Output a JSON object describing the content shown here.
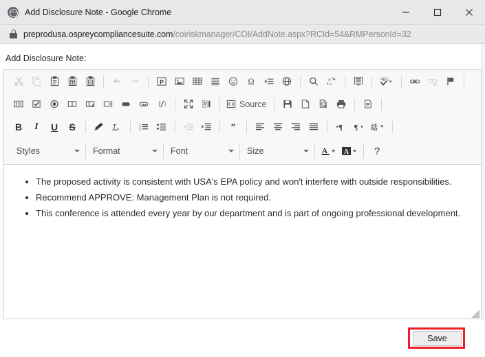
{
  "window": {
    "title": "Add Disclosure Note - Google Chrome",
    "favicon": "globe-icon",
    "controls": {
      "minimize": "minimize-icon",
      "maximize": "maximize-icon",
      "close": "close-icon"
    }
  },
  "address_bar": {
    "lock": "lock-icon",
    "host": "preprodusa.ospreycompliancesuite.com",
    "path": "/coiriskmanager/COI/AddNote.aspx?RCId=54&RMPersonId=32",
    "full_url": "preprodusa.ospreycompliancesuite.com/coiriskmanager/COI/AddNote.aspx?RCId=54&RMPersonId=32"
  },
  "page": {
    "label": "Add Disclosure Note:"
  },
  "editor": {
    "toolbar_rows": [
      {
        "name": "clipboard-and-insert-row",
        "items": [
          {
            "name": "cut-button",
            "icon": "scissors-icon",
            "label": "Cut",
            "disabled": true
          },
          {
            "name": "copy-button",
            "icon": "copy-icon",
            "label": "Copy",
            "disabled": true
          },
          {
            "name": "paste-button",
            "icon": "paste-icon",
            "label": "Paste",
            "disabled": false
          },
          {
            "name": "paste-as-plain-text-button",
            "icon": "paste-text-icon",
            "label": "Paste as plain text",
            "disabled": false
          },
          {
            "name": "paste-from-word-button",
            "icon": "paste-word-icon",
            "label": "Paste from Word",
            "disabled": false
          },
          {
            "name": "separator",
            "icon": "separator",
            "label": "",
            "disabled": false
          },
          {
            "name": "undo-button",
            "icon": "undo-arrow-icon",
            "label": "Undo",
            "disabled": true
          },
          {
            "name": "redo-button",
            "icon": "redo-arrow-icon",
            "label": "Redo",
            "disabled": true
          },
          {
            "name": "separator",
            "icon": "separator",
            "label": "",
            "disabled": false
          },
          {
            "name": "insert-placeholder-button",
            "icon": "placeholder-p-icon",
            "label": "Placeholder",
            "disabled": false
          },
          {
            "name": "insert-image-button",
            "icon": "image-icon",
            "label": "Image",
            "disabled": false
          },
          {
            "name": "insert-table-button",
            "icon": "table-icon",
            "label": "Table",
            "disabled": false
          },
          {
            "name": "insert-horizontal-line-button",
            "icon": "horizontal-line-icon",
            "label": "Horizontal Line",
            "disabled": false
          },
          {
            "name": "insert-smiley-button",
            "icon": "smiley-icon",
            "label": "Smiley",
            "disabled": false
          },
          {
            "name": "insert-special-character-button",
            "icon": "omega-icon",
            "label": "Special Character",
            "disabled": false
          },
          {
            "name": "insert-page-break-button",
            "icon": "page-break-icon",
            "label": "Page Break",
            "disabled": false
          },
          {
            "name": "insert-iframe-button",
            "icon": "globe-iframe-icon",
            "label": "IFrame",
            "disabled": false
          },
          {
            "name": "separator",
            "icon": "separator",
            "label": "",
            "disabled": false
          },
          {
            "name": "find-button",
            "icon": "magnifier-icon",
            "label": "Find",
            "disabled": false
          },
          {
            "name": "replace-button",
            "icon": "replace-ba-icon",
            "label": "Replace",
            "disabled": false
          },
          {
            "name": "separator",
            "icon": "separator",
            "label": "",
            "disabled": false
          },
          {
            "name": "select-all-button",
            "icon": "select-all-icon",
            "label": "Select All",
            "disabled": false
          },
          {
            "name": "separator",
            "icon": "separator",
            "label": "",
            "disabled": false
          },
          {
            "name": "spell-check-button",
            "icon": "spellcheck-abc-icon",
            "label": "Spell Check As You Type",
            "disabled": false
          },
          {
            "name": "separator",
            "icon": "separator",
            "label": "",
            "disabled": false
          },
          {
            "name": "link-button",
            "icon": "link-icon",
            "label": "Link",
            "disabled": false
          },
          {
            "name": "unlink-button",
            "icon": "unlink-icon",
            "label": "Unlink",
            "disabled": true
          },
          {
            "name": "anchor-button",
            "icon": "flag-anchor-icon",
            "label": "Anchor",
            "disabled": false
          },
          {
            "name": "separator",
            "icon": "separator",
            "label": "",
            "disabled": false
          }
        ]
      },
      {
        "name": "forms-and-document-row",
        "items": [
          {
            "name": "form-button",
            "icon": "form-icon",
            "label": "Form",
            "disabled": false
          },
          {
            "name": "checkbox-button",
            "icon": "checkbox-icon",
            "label": "Checkbox",
            "disabled": false
          },
          {
            "name": "radio-button",
            "icon": "radio-button-icon",
            "label": "Radio Button",
            "disabled": false
          },
          {
            "name": "text-field-button",
            "icon": "text-field-icon",
            "label": "Text Field",
            "disabled": false
          },
          {
            "name": "textarea-button",
            "icon": "textarea-icon",
            "label": "Textarea",
            "disabled": false
          },
          {
            "name": "selection-field-button",
            "icon": "select-dropdown-icon",
            "label": "Selection Field",
            "disabled": false
          },
          {
            "name": "button-button",
            "icon": "button-icon",
            "label": "Button",
            "disabled": false
          },
          {
            "name": "image-button-button",
            "icon": "image-button-icon",
            "label": "Image Button",
            "disabled": false
          },
          {
            "name": "hidden-field-button",
            "icon": "hidden-field-icon",
            "label": "Hidden Field",
            "disabled": false
          },
          {
            "name": "separator",
            "icon": "separator",
            "label": "",
            "disabled": false
          },
          {
            "name": "maximize-editor-button",
            "icon": "maximize-arrows-icon",
            "label": "Maximize",
            "disabled": false
          },
          {
            "name": "show-blocks-button",
            "icon": "show-blocks-icon",
            "label": "Show Blocks",
            "disabled": false
          },
          {
            "name": "separator",
            "icon": "separator",
            "label": "",
            "disabled": false
          },
          {
            "name": "source-button",
            "icon": "source-code-icon",
            "label": "Source",
            "disabled": false
          },
          {
            "name": "separator",
            "icon": "separator",
            "label": "",
            "disabled": false
          },
          {
            "name": "save-document-button",
            "icon": "floppy-disk-icon",
            "label": "Save",
            "disabled": false
          },
          {
            "name": "new-page-button",
            "icon": "new-page-icon",
            "label": "New Page",
            "disabled": false
          },
          {
            "name": "preview-button",
            "icon": "preview-icon",
            "label": "Preview",
            "disabled": false
          },
          {
            "name": "print-button",
            "icon": "printer-icon",
            "label": "Print",
            "disabled": false
          },
          {
            "name": "separator",
            "icon": "separator",
            "label": "",
            "disabled": false
          },
          {
            "name": "templates-button",
            "icon": "templates-icon",
            "label": "Templates",
            "disabled": false
          },
          {
            "name": "separator",
            "icon": "separator",
            "label": "",
            "disabled": false
          }
        ]
      },
      {
        "name": "text-formatting-row",
        "items": [
          {
            "name": "bold-button",
            "icon": "bold-b-icon",
            "label": "B",
            "disabled": false
          },
          {
            "name": "italic-button",
            "icon": "italic-i-icon",
            "label": "I",
            "disabled": false
          },
          {
            "name": "underline-button",
            "icon": "underline-u-icon",
            "label": "U",
            "disabled": false
          },
          {
            "name": "strikethrough-button",
            "icon": "strikethrough-s-icon",
            "label": "S",
            "disabled": false
          },
          {
            "name": "separator",
            "icon": "separator",
            "label": "",
            "disabled": false
          },
          {
            "name": "copy-formatting-button",
            "icon": "paintbrush-icon",
            "label": "Copy Formatting",
            "disabled": false
          },
          {
            "name": "remove-format-button",
            "icon": "remove-format-tx-icon",
            "label": "Remove Format",
            "disabled": false
          },
          {
            "name": "separator",
            "icon": "separator",
            "label": "",
            "disabled": false
          },
          {
            "name": "numbered-list-button",
            "icon": "numbered-list-icon",
            "label": "Insert/Remove Numbered List",
            "disabled": false
          },
          {
            "name": "bulleted-list-button",
            "icon": "bulleted-list-icon",
            "label": "Insert/Remove Bulleted List",
            "disabled": false
          },
          {
            "name": "separator",
            "icon": "separator",
            "label": "",
            "disabled": false
          },
          {
            "name": "decrease-indent-button",
            "icon": "decrease-indent-icon",
            "label": "Decrease Indent",
            "disabled": true
          },
          {
            "name": "increase-indent-button",
            "icon": "increase-indent-icon",
            "label": "Increase Indent",
            "disabled": false
          },
          {
            "name": "separator",
            "icon": "separator",
            "label": "",
            "disabled": false
          },
          {
            "name": "blockquote-button",
            "icon": "blockquote-quotes-icon",
            "label": "Block Quote",
            "disabled": false
          },
          {
            "name": "separator",
            "icon": "separator",
            "label": "",
            "disabled": false
          },
          {
            "name": "align-left-button",
            "icon": "align-left-icon",
            "label": "Align Left",
            "disabled": false
          },
          {
            "name": "align-center-button",
            "icon": "align-center-icon",
            "label": "Center",
            "disabled": false
          },
          {
            "name": "align-right-button",
            "icon": "align-right-icon",
            "label": "Align Right",
            "disabled": false
          },
          {
            "name": "justify-button",
            "icon": "justify-icon",
            "label": "Justify",
            "disabled": false
          },
          {
            "name": "separator",
            "icon": "separator",
            "label": "",
            "disabled": false
          },
          {
            "name": "text-direction-ltr-button",
            "icon": "direction-ltr-icon",
            "label": "Text direction from left to right",
            "disabled": false
          },
          {
            "name": "text-direction-rtl-button",
            "icon": "direction-rtl-icon",
            "label": "Text direction from right to left",
            "disabled": false
          },
          {
            "name": "language-button",
            "icon": "language-kanji-icon",
            "label": "Set Language",
            "disabled": false
          },
          {
            "name": "separator",
            "icon": "separator",
            "label": "",
            "disabled": false
          }
        ]
      }
    ],
    "dropdowns": [
      {
        "name": "styles-dropdown",
        "label": "Styles"
      },
      {
        "name": "format-dropdown",
        "label": "Format"
      },
      {
        "name": "font-dropdown",
        "label": "Font"
      },
      {
        "name": "size-dropdown",
        "label": "Size"
      }
    ],
    "color_tools": [
      {
        "name": "text-color-button",
        "icon": "text-color-a-icon",
        "label": "Text Color"
      },
      {
        "name": "background-color-button",
        "icon": "background-color-a-icon",
        "label": "Background Color"
      }
    ],
    "about_button": {
      "name": "about-button",
      "icon": "question-mark-icon",
      "label": "?"
    },
    "content": {
      "bullets": [
        "The proposed activity is consistent with USA's EPA policy and won't interfere with outside responsibilities.",
        "Recommend APPROVE: Management Plan is not required.",
        "This conference is attended every year by our department and is part of ongoing professional development."
      ]
    },
    "resize_grip": "resize-grip-icon"
  },
  "footer": {
    "save_label": "Save"
  },
  "colors": {
    "highlight": "#ee1b24",
    "titlebar": "#e8e8e8",
    "urlbar": "#eaeaea",
    "toolbar": "#f8f8f8",
    "text": "#2b2b2b",
    "url_dim": "#8b8b8b"
  }
}
